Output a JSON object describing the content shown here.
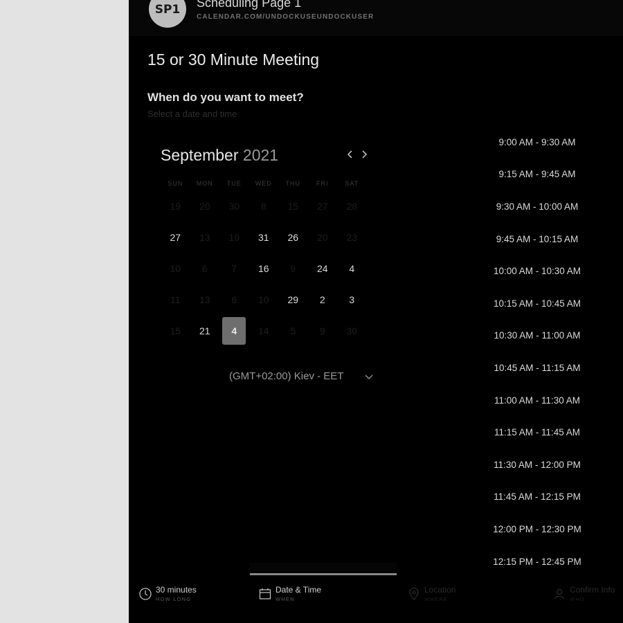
{
  "header": {
    "avatar_initials": "SP1",
    "page_name": "Scheduling Page 1",
    "page_url": "CALENDAR.COM/UNDOCKUSEUNDOCKUSER"
  },
  "meeting": {
    "title": "15 or 30 Minute Meeting",
    "question": "When do you want to meet?",
    "subtitle": "Select a date and time"
  },
  "calendar": {
    "month": "September",
    "year": "2021",
    "weekdays": [
      "SUN",
      "MON",
      "TUE",
      "WED",
      "THU",
      "FRI",
      "SAT"
    ],
    "weeks": [
      [
        {
          "d": "19",
          "a": false
        },
        {
          "d": "20",
          "a": false
        },
        {
          "d": "30",
          "a": false
        },
        {
          "d": "8",
          "a": false
        },
        {
          "d": "15",
          "a": false
        },
        {
          "d": "27",
          "a": false
        },
        {
          "d": "28",
          "a": false
        }
      ],
      [
        {
          "d": "27",
          "a": true
        },
        {
          "d": "13",
          "a": false
        },
        {
          "d": "19",
          "a": false
        },
        {
          "d": "31",
          "a": true
        },
        {
          "d": "26",
          "a": true
        },
        {
          "d": "20",
          "a": false
        },
        {
          "d": "23",
          "a": false
        }
      ],
      [
        {
          "d": "10",
          "a": false
        },
        {
          "d": "6",
          "a": false
        },
        {
          "d": "7",
          "a": false
        },
        {
          "d": "16",
          "a": true
        },
        {
          "d": "9",
          "a": false
        },
        {
          "d": "24",
          "a": true
        },
        {
          "d": "4",
          "a": true
        }
      ],
      [
        {
          "d": "11",
          "a": false
        },
        {
          "d": "13",
          "a": false
        },
        {
          "d": "6",
          "a": false
        },
        {
          "d": "10",
          "a": false
        },
        {
          "d": "29",
          "a": true
        },
        {
          "d": "2",
          "a": true
        },
        {
          "d": "3",
          "a": true
        }
      ],
      [
        {
          "d": "15",
          "a": false
        },
        {
          "d": "21",
          "a": true
        },
        {
          "d": "4",
          "a": true,
          "selected": true
        },
        {
          "d": "14",
          "a": false
        },
        {
          "d": "5",
          "a": false
        },
        {
          "d": "9",
          "a": false
        },
        {
          "d": "30",
          "a": false
        }
      ]
    ]
  },
  "timezone": {
    "label": "(GMT+02:00) Kiev - EET"
  },
  "time_slots": [
    "9:00 AM - 9:30 AM",
    "9:15 AM - 9:45 AM",
    "9:30 AM - 10:00 AM",
    "9:45 AM - 10:15 AM",
    "10:00 AM - 10:30 AM",
    "10:15 AM - 10:45 AM",
    "10:30 AM - 11:00 AM",
    "10:45 AM - 11:15 AM",
    "11:00 AM - 11:30 AM",
    "11:15 AM - 11:45 AM",
    "11:30 AM - 12:00 PM",
    "11:45 AM - 12:15 PM",
    "12:00 PM - 12:30 PM",
    "12:15 PM - 12:45 PM"
  ],
  "steps": [
    {
      "label": "30 minutes",
      "sub": "HOW LONG",
      "icon": "clock-icon"
    },
    {
      "label": "Date & Time",
      "sub": "WHEN",
      "icon": "calendar-icon"
    },
    {
      "label": "Location",
      "sub": "WHERE",
      "icon": "location-pin-icon"
    },
    {
      "label": "Confirm Info",
      "sub": "WHO",
      "icon": "user-icon"
    }
  ],
  "colors": {
    "panel_bg": "#000000",
    "left_bg": "#e3e3e3",
    "selected_day": "#6e6e6e",
    "text": "#dcdcdc"
  }
}
